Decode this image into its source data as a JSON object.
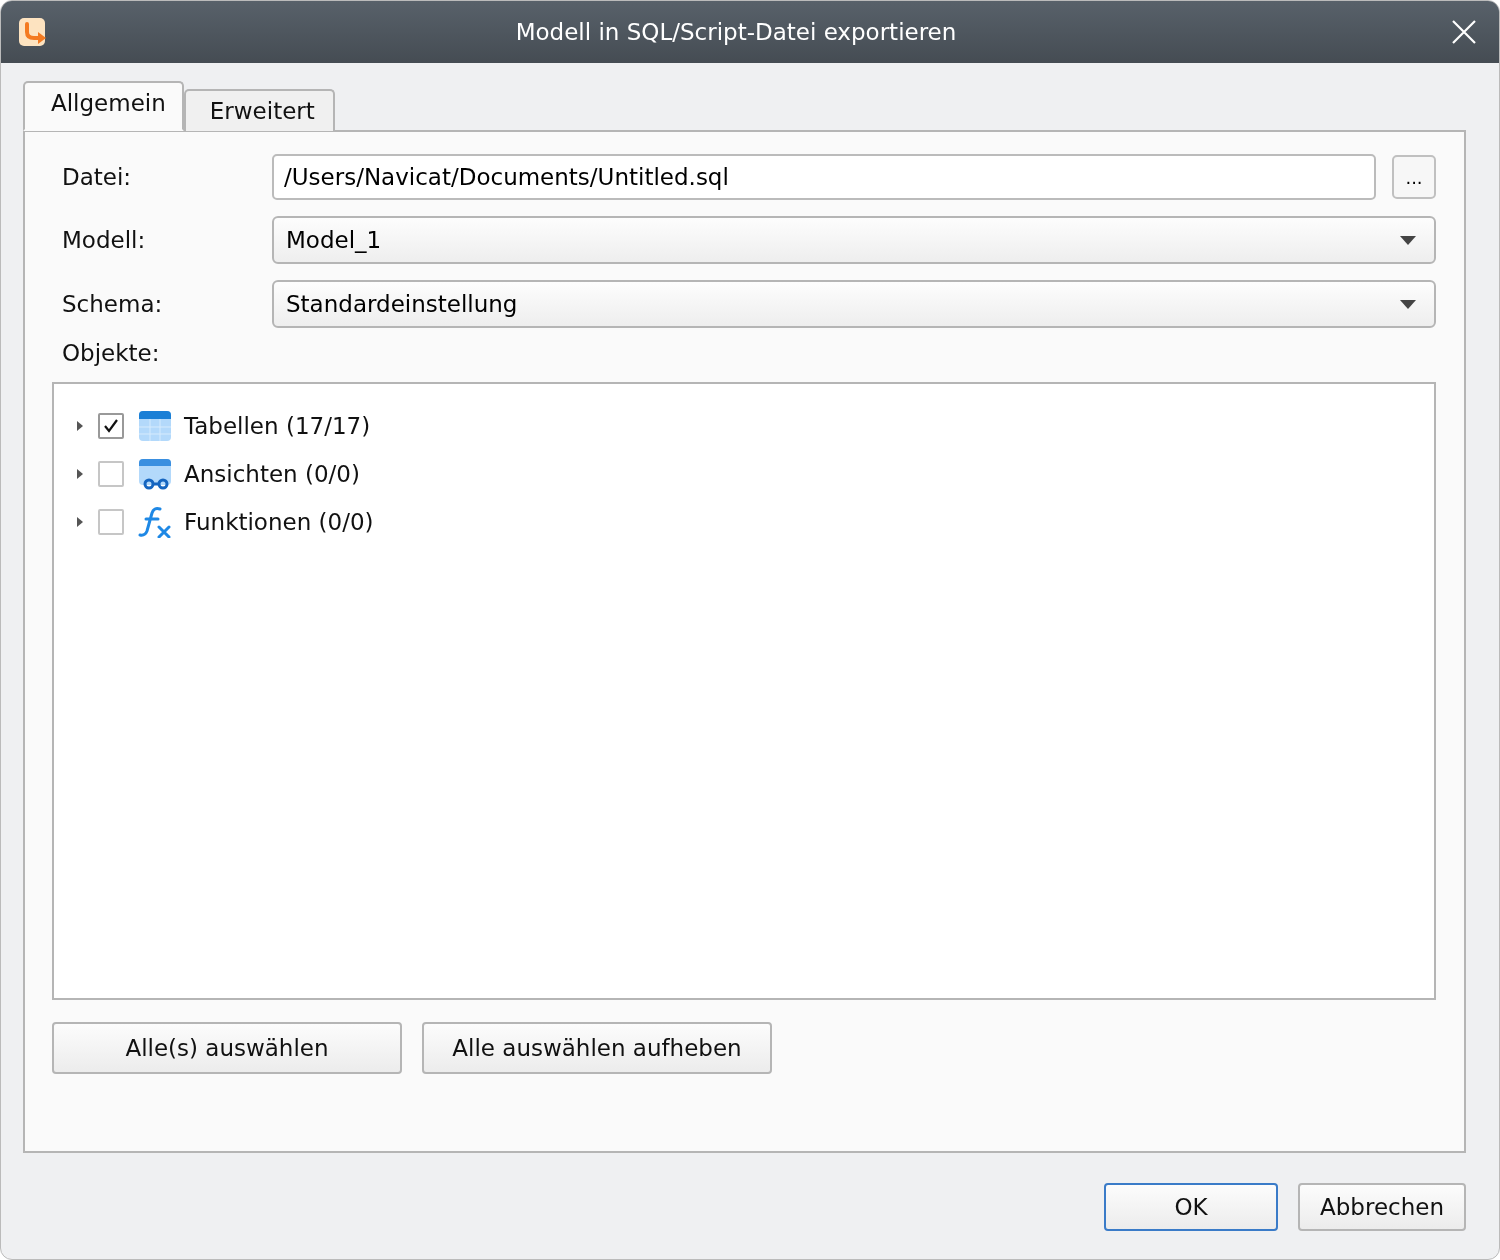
{
  "window": {
    "title": "Modell in SQL/Script-Datei exportieren"
  },
  "tabs": [
    {
      "label": "Allgemein",
      "selected": true
    },
    {
      "label": "Erweitert",
      "selected": false
    }
  ],
  "form": {
    "file_label": "Datei:",
    "file_value": "/Users/Navicat/Documents/Untitled.sql",
    "browse_button": "...",
    "model_label": "Modell:",
    "model_value": "Model_1",
    "schema_label": "Schema:",
    "schema_value": "Standardeinstellung",
    "objects_label": "Objekte:"
  },
  "objects": [
    {
      "kind": "table",
      "label": "Tabellen (17/17)",
      "checked": true,
      "expanded": false
    },
    {
      "kind": "view",
      "label": "Ansichten (0/0)",
      "checked": false,
      "expanded": false
    },
    {
      "kind": "function",
      "label": "Funktionen (0/0)",
      "checked": false,
      "expanded": false
    }
  ],
  "selection_buttons": [
    "Alle(s) auswählen",
    "Alle auswählen aufheben"
  ],
  "footer_buttons": [
    {
      "label": "OK",
      "kind": "default"
    },
    {
      "label": "Abbrechen",
      "kind": "normal"
    }
  ]
}
